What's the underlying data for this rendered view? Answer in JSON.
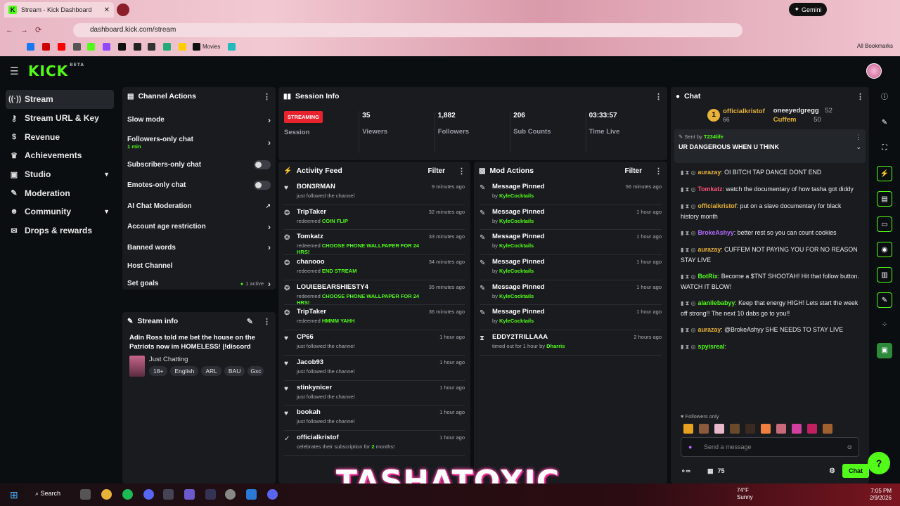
{
  "browser": {
    "tab_title": "Stream - Kick Dashboard",
    "url": "dashboard.kick.com/stream",
    "gemini_label": "Gemini",
    "bookmarks_label": "Movies",
    "all_bookmarks": "All Bookmarks"
  },
  "header": {
    "logo": "KICK",
    "beta": "BETA"
  },
  "sidebar": {
    "items": [
      {
        "label": "Stream",
        "icon": "broadcast-icon"
      },
      {
        "label": "Stream URL & Key",
        "icon": "key-icon"
      },
      {
        "label": "Revenue",
        "icon": "dollar-icon"
      },
      {
        "label": "Achievements",
        "icon": "trophy-icon"
      },
      {
        "label": "Studio",
        "icon": "studio-icon"
      },
      {
        "label": "Moderation",
        "icon": "wrench-icon"
      },
      {
        "label": "Community",
        "icon": "people-icon"
      },
      {
        "label": "Drops & rewards",
        "icon": "gift-icon"
      }
    ]
  },
  "channel_actions": {
    "title": "Channel Actions",
    "slow_mode": "Slow mode",
    "followers_only": "Followers-only chat",
    "followers_sub": "1 min",
    "subscribers_only": "Subscribers-only chat",
    "emotes_only": "Emotes-only chat",
    "ai_moderation": "AI Chat Moderation",
    "account_age": "Account age restriction",
    "banned_words": "Banned words",
    "host_channel": "Host Channel",
    "set_goals": "Set goals",
    "goals_active": "1 active"
  },
  "stream_info": {
    "title": "Stream info",
    "stream_title": "Adin Ross told me bet the house on the Patriots now im HOMELESS! |!discord",
    "category": "Just Chatting",
    "tags": [
      "18+",
      "English",
      "ARL",
      "BAU",
      "Gxc"
    ]
  },
  "session": {
    "title": "Session Info",
    "status": "STREAMING",
    "status_label": "Session",
    "stats": [
      {
        "value": "35",
        "label": "Viewers"
      },
      {
        "value": "1,882",
        "label": "Followers"
      },
      {
        "value": "206",
        "label": "Sub Counts"
      },
      {
        "value": "03:33:57",
        "label": "Time Live"
      }
    ]
  },
  "activity": {
    "title": "Activity Feed",
    "filter": "Filter",
    "items": [
      {
        "name": "BON3RMAN",
        "desc": "just followed the channel",
        "hl": "",
        "time": "9 minutes ago",
        "icon": "heart-icon"
      },
      {
        "name": "TripTaker",
        "desc": "redeemed ",
        "hl": "COIN FLIP",
        "time": "32 minutes ago",
        "icon": "reward-icon"
      },
      {
        "name": "Tomkatz",
        "desc": "redeemed ",
        "hl": "CHOOSE PHONE WALLPAPER FOR 24 HRS!",
        "time": "33 minutes ago",
        "icon": "reward-icon"
      },
      {
        "name": "chanooo",
        "desc": "redeemed ",
        "hl": "END STREAM",
        "time": "34 minutes ago",
        "icon": "reward-icon"
      },
      {
        "name": "LOUIEBEARSHIESTY4",
        "desc": "redeemed ",
        "hl": "CHOOSE PHONE WALLPAPER FOR 24 HRS!",
        "time": "35 minutes ago",
        "icon": "reward-icon"
      },
      {
        "name": "TripTaker",
        "desc": "redeemed ",
        "hl": "HMMM YAHH",
        "time": "36 minutes ago",
        "icon": "reward-icon"
      },
      {
        "name": "CP66",
        "desc": "just followed the channel",
        "hl": "",
        "time": "1 hour ago",
        "icon": "heart-icon"
      },
      {
        "name": "Jacob93",
        "desc": "just followed the channel",
        "hl": "",
        "time": "1 hour ago",
        "icon": "heart-icon"
      },
      {
        "name": "stinkynicer",
        "desc": "just followed the channel",
        "hl": "",
        "time": "1 hour ago",
        "icon": "heart-icon"
      },
      {
        "name": "bookah",
        "desc": "just followed the channel",
        "hl": "",
        "time": "1 hour ago",
        "icon": "heart-icon"
      },
      {
        "name": "officialkristof",
        "desc": "celebrates their subscription for ",
        "hl": "2",
        "desc2": " months!",
        "time": "1 hour ago",
        "icon": "sub-icon"
      }
    ]
  },
  "mod_actions": {
    "title": "Mod Actions",
    "filter": "Filter",
    "items": [
      {
        "name": "Message Pinned",
        "by": "by ",
        "mod": "KyleCocktails",
        "time": "56 minutes ago"
      },
      {
        "name": "Message Pinned",
        "by": "by ",
        "mod": "KyleCocktails",
        "time": "1 hour ago"
      },
      {
        "name": "Message Pinned",
        "by": "by ",
        "mod": "KyleCocktails",
        "time": "1 hour ago"
      },
      {
        "name": "Message Pinned",
        "by": "by ",
        "mod": "KyleCocktails",
        "time": "1 hour ago"
      },
      {
        "name": "Message Pinned",
        "by": "by ",
        "mod": "KyleCocktails",
        "time": "1 hour ago"
      },
      {
        "name": "Message Pinned",
        "by": "by ",
        "mod": "KyleCocktails",
        "time": "1 hour ago"
      },
      {
        "name": "EDDY2TRILLAAA",
        "by": "timed out for 1 hour by ",
        "mod": "Dharris",
        "time": "2 hours ago"
      }
    ]
  },
  "chat": {
    "title": "Chat",
    "top1_name": "officialkristof",
    "top1_count": "66",
    "top1_rank": "1",
    "top2_name": "oneeyedgregg",
    "top2_count": "52",
    "top3_name": "Cuffem",
    "top3_count": "50",
    "pinned_by_label": "Sent by ",
    "pinned_by": "T234life",
    "pinned_msg": "UR DANGEROUS WHEN U THINK",
    "messages": [
      {
        "user": "aurazay",
        "color": "#e8b33a",
        "text": ": OI BITCH TAP DANCE DONT END"
      },
      {
        "user": "Tomkatz",
        "color": "#ff5577",
        "text": ": watch the documentary of how tasha got diddy"
      },
      {
        "user": "officialkristof",
        "color": "#e8b33a",
        "text": ": put on a slave documentary for black history month"
      },
      {
        "user": "BrokeAshyy",
        "color": "#b36cff",
        "text": ": better rest so you can count cookies"
      },
      {
        "user": "aurazay",
        "color": "#e8b33a",
        "text": ": CUFFEM NOT PAYING YOU FOR NO REASON STAY LIVE"
      },
      {
        "user": "BotRix",
        "color": "#53fc18",
        "text": ": Become a $TNT SHOOTAH! Hit that follow button. WATCH IT BLOW!"
      },
      {
        "user": "alanilebabyy",
        "color": "#53fc18",
        "text": ": Keep that energy HIGH! Lets start the week off strong!! The next 10 dabs go to you!!"
      },
      {
        "user": "aurazay",
        "color": "#e8b33a",
        "text": ": @BrokeAshyy SHE NEEDS TO STAY LIVE"
      },
      {
        "user": "spyisreal",
        "color": "#53fc18",
        "text": ":"
      }
    ],
    "followers_only": "Followers only",
    "input_placeholder": "Send a message",
    "points": "75",
    "send": "Chat"
  },
  "overlay": {
    "text": "TASHATOXIC"
  },
  "taskbar": {
    "search": "Search",
    "temp": "74°F",
    "weather": "Sunny",
    "time": "7:05 PM",
    "date": "2/9/2026"
  },
  "colors": {
    "accent": "#53fc18",
    "live": "#e8232e",
    "panel": "#191b1f"
  }
}
